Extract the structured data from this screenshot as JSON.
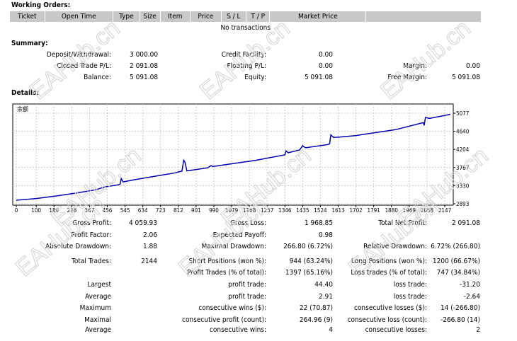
{
  "working_orders": {
    "title": "Working Orders:",
    "columns": [
      "Ticket",
      "Open Time",
      "Type",
      "Size",
      "Item",
      "Price",
      "S / L",
      "T / P",
      "Market Price",
      ""
    ],
    "empty_text": "No transactions"
  },
  "summary": {
    "title": "Summary:",
    "rows": [
      [
        [
          "Deposit/Withdrawal:",
          "3 000.00"
        ],
        [
          "Credit Facility:",
          "0.00"
        ],
        [
          "",
          ""
        ]
      ],
      [
        [
          "Closed Trade P/L:",
          "2 091.08"
        ],
        [
          "Floating P/L:",
          "0.00"
        ],
        [
          "Margin:",
          "0.00"
        ]
      ],
      [
        [
          "Balance:",
          "5 091.08"
        ],
        [
          "Equity:",
          "5 091.08"
        ],
        [
          "Free Margin:",
          "5 091.08"
        ]
      ]
    ]
  },
  "details": {
    "title": "Details:",
    "rows": [
      [
        [
          "Gross Profit:",
          "4 059.93"
        ],
        [
          "Gross Loss:",
          "1 968.85"
        ],
        [
          "Total Net Profit:",
          "2 091.08"
        ]
      ],
      [
        [
          "Profit Factor:",
          "2.06"
        ],
        [
          "Expected Payoff:",
          "0.98"
        ],
        [
          "",
          ""
        ]
      ],
      [
        [
          "Absolute Drawdown:",
          "1.88"
        ],
        [
          "Maximal Drawdown:",
          "266.80 (6.72%)"
        ],
        [
          "Relative Drawdown:",
          "6.72% (266.80)"
        ]
      ],
      [
        [
          "Total Trades:",
          "2144"
        ],
        [
          "Short Positions (won %):",
          "944 (63.24%)"
        ],
        [
          "Long Positions (won %):",
          "1200 (66.67%)"
        ]
      ],
      [
        [
          "",
          ""
        ],
        [
          "Profit Trades (% of total):",
          "1397 (65.16%)"
        ],
        [
          "Loss trades (% of total):",
          "747 (34.84%)"
        ]
      ],
      [
        [
          "Largest",
          ""
        ],
        [
          "profit trade:",
          "44.40"
        ],
        [
          "loss trade:",
          "-31.20"
        ]
      ],
      [
        [
          "Average",
          ""
        ],
        [
          "profit trade:",
          "2.91"
        ],
        [
          "loss trade:",
          "-2.64"
        ]
      ],
      [
        [
          "Maximum",
          ""
        ],
        [
          "consecutive wins ($):",
          "22 (70.87)"
        ],
        [
          "consecutive losses ($):",
          "14 (-266.80)"
        ]
      ],
      [
        [
          "Maximal",
          ""
        ],
        [
          "consecutive profit (count):",
          "264.96 (9)"
        ],
        [
          "consecutive loss (count):",
          "-266.80 (14)"
        ]
      ],
      [
        [
          "Average",
          ""
        ],
        [
          "consecutive wins:",
          "4"
        ],
        [
          "consecutive losses:",
          "2"
        ]
      ]
    ]
  },
  "watermark": "EAHub.cn",
  "chart_data": {
    "type": "line",
    "title": "余额",
    "line_color": "#0000b0",
    "x_ticks": [
      0,
      100,
      189,
      278,
      367,
      456,
      545,
      634,
      723,
      812,
      901,
      990,
      1079,
      1168,
      1257,
      1346,
      1435,
      1524,
      1613,
      1702,
      1791,
      1880,
      1969,
      2058,
      2147
    ],
    "y_ticks": [
      2893,
      3330,
      3767,
      4204,
      4640,
      5077
    ],
    "xlim": [
      0,
      2175
    ],
    "ylim": [
      2893,
      5077
    ],
    "series": [
      {
        "name": "Balance",
        "x": [
          0,
          100,
          200,
          300,
          400,
          444,
          500,
          520,
          526,
          535,
          600,
          700,
          800,
          811,
          830,
          839,
          845,
          855,
          960,
          975,
          985,
          1079,
          1200,
          1346,
          1352,
          1362,
          1420,
          1435,
          1440,
          1450,
          1560,
          1570,
          1576,
          1590,
          1620,
          1702,
          1900,
          2040,
          2044,
          2050,
          2070,
          2175
        ],
        "y": [
          2978,
          3020,
          3080,
          3150,
          3230,
          3301,
          3340,
          3360,
          3500,
          3420,
          3480,
          3560,
          3640,
          3659,
          3680,
          3942,
          3900,
          3687,
          3760,
          3812,
          3790,
          3857,
          3940,
          4073,
          4170,
          4124,
          4190,
          4294,
          4270,
          4243,
          4320,
          4340,
          4555,
          4493,
          4500,
          4538,
          4680,
          4850,
          4782,
          4975,
          4950,
          5049
        ]
      }
    ]
  }
}
